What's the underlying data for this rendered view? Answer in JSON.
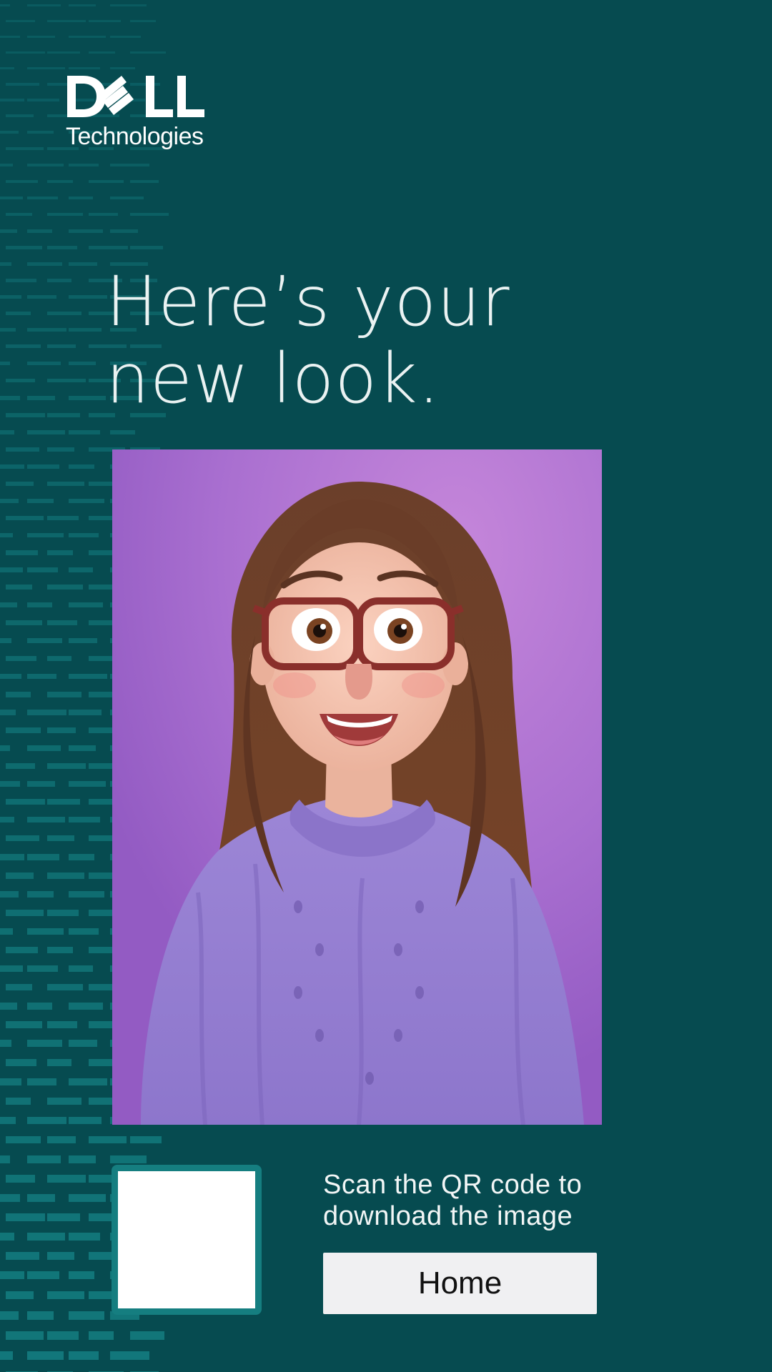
{
  "brand": {
    "logo_text": "DELL",
    "logo_subtext": "Technologies"
  },
  "headline": {
    "line1": "Here’s your",
    "line2": "new look."
  },
  "portrait": {
    "alt": "Generated cartoon portrait"
  },
  "qr": {
    "instruction_line1": "Scan the QR code to",
    "instruction_line2": "download the image"
  },
  "actions": {
    "home_label": "Home"
  },
  "colors": {
    "background": "#064b50",
    "accent": "#157e80",
    "dash": "#137a7d",
    "portrait_bg": "#a86fcf",
    "button_bg": "#f0f0f2"
  }
}
